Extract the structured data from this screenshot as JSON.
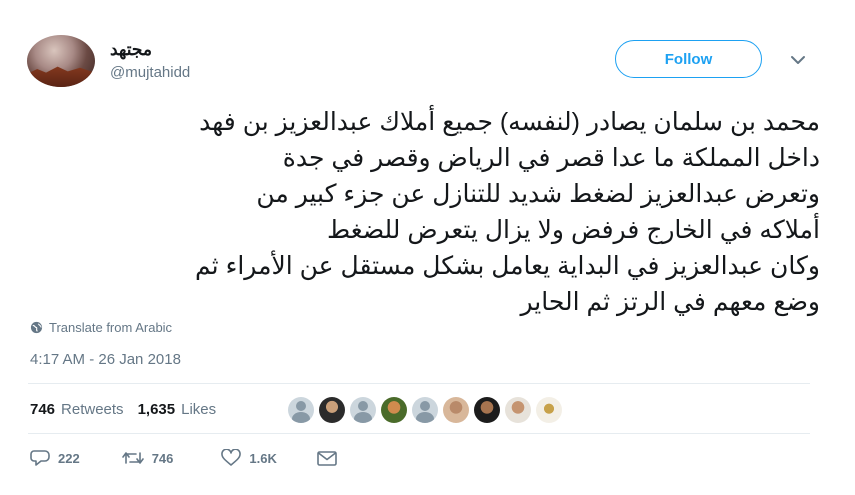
{
  "user": {
    "display_name": "مجتهد",
    "handle": "@mujtahidd",
    "follow_label": "Follow"
  },
  "tweet": {
    "lines": [
      "محمد بن سلمان يصادر (لنفسه) جميع أملاك عبدالعزيز بن فهد",
      "داخل المملكة ما عدا قصر في الرياض وقصر في جدة",
      "وتعرض عبدالعزيز لضغط شديد للتنازل عن جزء كبير من",
      "أملاكه في الخارج فرفض ولا يزال يتعرض للضغط",
      "وكان عبدالعزيز في البداية يعامل بشكل مستقل عن الأمراء ثم",
      "وضع معهم في الرتز ثم الحاير"
    ],
    "translate_label": "Translate from Arabic",
    "timestamp": "4:17 AM - 26 Jan 2018"
  },
  "stats": {
    "retweets_count": "746",
    "retweets_label": "Retweets",
    "likes_count": "1,635",
    "likes_label": "Likes"
  },
  "actions": {
    "replies": "222",
    "retweets": "746",
    "likes": "1.6K"
  },
  "colors": {
    "accent": "#1da1f2",
    "muted": "#657786",
    "text": "#14171a",
    "divider": "#e6ecf0"
  }
}
